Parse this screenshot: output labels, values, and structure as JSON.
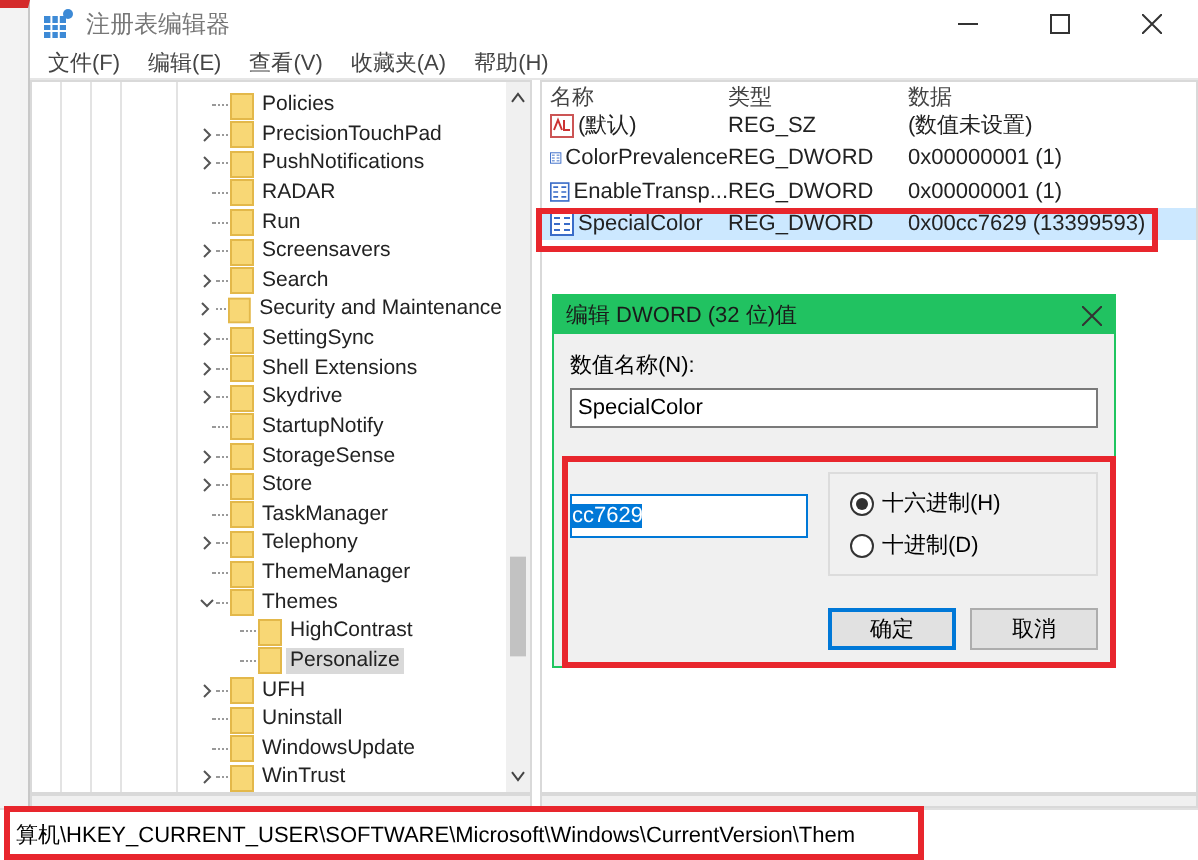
{
  "window": {
    "title": "注册表编辑器"
  },
  "menu": [
    "文件(F)",
    "编辑(E)",
    "查看(V)",
    "收藏夹(A)",
    "帮助(H)"
  ],
  "tree": [
    {
      "label": "Policies",
      "kind": "leaf",
      "expanded": false,
      "selected": false
    },
    {
      "label": "PrecisionTouchPad",
      "kind": "branch",
      "expanded": false,
      "selected": false
    },
    {
      "label": "PushNotifications",
      "kind": "branch",
      "expanded": false,
      "selected": false
    },
    {
      "label": "RADAR",
      "kind": "leaf",
      "expanded": false,
      "selected": false
    },
    {
      "label": "Run",
      "kind": "leaf",
      "expanded": false,
      "selected": false
    },
    {
      "label": "Screensavers",
      "kind": "branch",
      "expanded": false,
      "selected": false
    },
    {
      "label": "Search",
      "kind": "branch",
      "expanded": false,
      "selected": false
    },
    {
      "label": "Security and Maintenance",
      "kind": "branch",
      "expanded": false,
      "selected": false
    },
    {
      "label": "SettingSync",
      "kind": "branch",
      "expanded": false,
      "selected": false
    },
    {
      "label": "Shell Extensions",
      "kind": "branch",
      "expanded": false,
      "selected": false
    },
    {
      "label": "Skydrive",
      "kind": "branch",
      "expanded": false,
      "selected": false
    },
    {
      "label": "StartupNotify",
      "kind": "leaf",
      "expanded": false,
      "selected": false
    },
    {
      "label": "StorageSense",
      "kind": "branch",
      "expanded": false,
      "selected": false
    },
    {
      "label": "Store",
      "kind": "branch",
      "expanded": false,
      "selected": false
    },
    {
      "label": "TaskManager",
      "kind": "leaf",
      "expanded": false,
      "selected": false
    },
    {
      "label": "Telephony",
      "kind": "branch",
      "expanded": false,
      "selected": false
    },
    {
      "label": "ThemeManager",
      "kind": "leaf",
      "expanded": false,
      "selected": false
    },
    {
      "label": "Themes",
      "kind": "branch",
      "expanded": true,
      "selected": false,
      "children": [
        {
          "label": "HighContrast",
          "kind": "leaf",
          "expanded": false,
          "selected": false
        },
        {
          "label": "Personalize",
          "kind": "leaf",
          "expanded": false,
          "selected": true
        }
      ]
    },
    {
      "label": "UFH",
      "kind": "branch",
      "expanded": false,
      "selected": false
    },
    {
      "label": "Uninstall",
      "kind": "leaf",
      "expanded": false,
      "selected": false
    },
    {
      "label": "WindowsUpdate",
      "kind": "leaf",
      "expanded": false,
      "selected": false
    },
    {
      "label": "WinTrust",
      "kind": "branch",
      "expanded": false,
      "selected": false
    }
  ],
  "values": {
    "columns": [
      "名称",
      "类型",
      "数据"
    ],
    "rows": [
      {
        "kind": "string",
        "name": "(默认)",
        "type": "REG_SZ",
        "data": "(数值未设置)",
        "selected": false
      },
      {
        "kind": "dword",
        "name": "ColorPrevalence",
        "type": "REG_DWORD",
        "data": "0x00000001 (1)",
        "selected": false
      },
      {
        "kind": "dword",
        "name": "EnableTransp...",
        "type": "REG_DWORD",
        "data": "0x00000001 (1)",
        "selected": false
      },
      {
        "kind": "dword",
        "name": "SpecialColor",
        "type": "REG_DWORD",
        "data": "0x00cc7629 (13399593)",
        "selected": true
      }
    ]
  },
  "dialog": {
    "title": "编辑 DWORD (32 位)值",
    "name_label": "数值名称(N):",
    "name_value": "SpecialColor",
    "data_value": "cc7629",
    "radios": [
      {
        "label": "十六进制(H)",
        "selected": true
      },
      {
        "label": "十进制(D)",
        "selected": false
      }
    ],
    "buttons": [
      {
        "label": "确定",
        "default": true
      },
      {
        "label": "取消",
        "default": false
      }
    ]
  },
  "status_bar": "算机\\HKEY_CURRENT_USER\\SOFTWARE\\Microsoft\\Windows\\CurrentVersion\\Them"
}
